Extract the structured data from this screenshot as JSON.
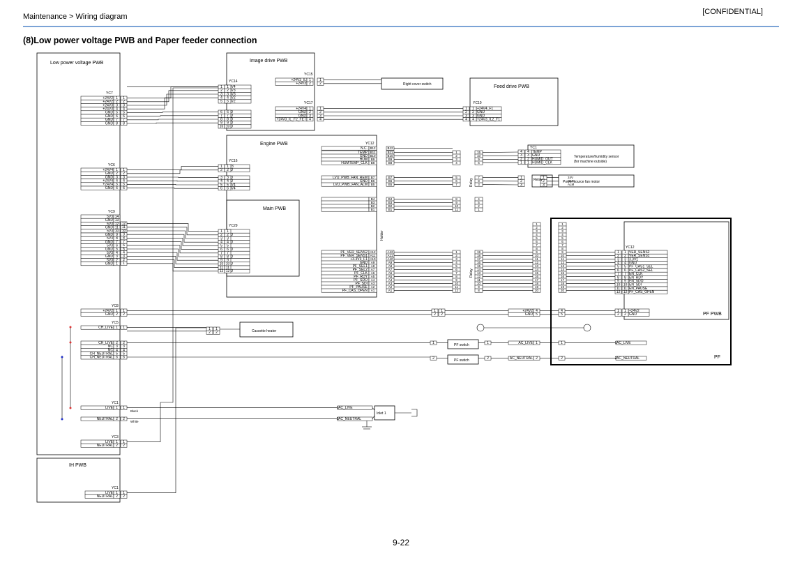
{
  "header": {
    "breadcrumb": "Maintenance > Wiring diagram",
    "confidential": "[CONFIDENTIAL]"
  },
  "page_title": "(8)Low power voltage PWB and Paper feeder connection",
  "page_number": "9-22",
  "diagram": {
    "boards": {
      "lvpwb": "Low power voltage PWB",
      "image_drive": "Image drive PWB",
      "feed_drive": "Feed drive PWB",
      "engine": "Engine PWB",
      "main": "Main PWB",
      "ih": "IH PWB",
      "pf_pwb": "PF PWB",
      "pf": "PF"
    },
    "components": {
      "right_cover_switch": "Right cover switch",
      "temp_sensor_1": "Temperature/humidity sensor",
      "temp_sensor_2": "(for machine outside)",
      "fan_motor": "Power source fan motor",
      "cassette_heater": "Cassette heater",
      "pf_switch": "PF switch",
      "inlet": "Inlet 1",
      "relay": "Relay",
      "holder": "Holder",
      "black": "Black",
      "white": "White"
    },
    "connectors": {
      "yc7": {
        "label": "YC7",
        "pins": [
          "1",
          "2",
          "3",
          "4",
          "5",
          "6",
          "7",
          "8"
        ],
        "signals": [
          "+24V2",
          "+24V2",
          "+24V3",
          "+24V3",
          "GND",
          "GND",
          "GND",
          "GND"
        ]
      },
      "yc6": {
        "label": "YC6",
        "pins": [
          "1",
          "2",
          "3",
          "4",
          "5",
          "6"
        ],
        "signals": [
          "+24V4",
          "GND",
          "GND",
          "+24V4",
          "+24V4",
          "GND"
        ]
      },
      "yc9": {
        "label": "YC9",
        "pins": [
          "14",
          "13",
          "12",
          "11",
          "10",
          "9",
          "8",
          "7",
          "6",
          "5",
          "4",
          "3",
          "2",
          "1"
        ],
        "signals": [
          "5V3",
          "GND",
          "5V3",
          "GND",
          "5V3",
          "GND",
          "5V3",
          "GND",
          "5V3",
          "GND",
          "5V3",
          "GND",
          "5V3",
          "GND"
        ]
      },
      "yc8": {
        "label": "YC8",
        "pins": [
          "1",
          "2"
        ],
        "signals": [
          "+24V2",
          "GND"
        ]
      },
      "yc5": {
        "label": "YC5",
        "pins": [
          "1",
          "2",
          "3",
          "4",
          "5",
          "6"
        ],
        "signals": [
          "CH_LIVE",
          "CH_LIVE",
          "NC",
          "NC",
          "CH_NEUTRAL",
          "CH_NEUTRAL"
        ]
      },
      "yc1_lv": {
        "label": "YC1",
        "pins": [
          "1",
          "2"
        ],
        "signals": [
          "LIVE",
          "NEUTRAL"
        ]
      },
      "yc3": {
        "label": "YC3",
        "pins": [
          "1",
          "2"
        ],
        "signals": [
          "LIVE",
          "NEUTRAL"
        ]
      },
      "yc1_ih": {
        "label": "YC1",
        "pins": [
          "1",
          "2"
        ],
        "signals": [
          "LIVE",
          "NEUTRAL"
        ]
      },
      "yc14": {
        "label": "YC14",
        "pins": [
          "1",
          "2",
          "3",
          "4",
          "5",
          "6",
          "7",
          "8",
          "9",
          "10"
        ],
        "signals": [
          "+24V4",
          "+24V3",
          "+24V3",
          "+24V2",
          "+24V2",
          "GND",
          "GND",
          "GND",
          "GND",
          "GND"
        ]
      },
      "yc15": {
        "label": "YC15",
        "pins": [
          "1",
          "2"
        ],
        "signals": [
          "+24V3_IL",
          "+24V3"
        ]
      },
      "yc17": {
        "label": "YC17",
        "pins": [
          "1",
          "2",
          "3",
          "4"
        ],
        "signals": [
          "+24V4",
          "GND",
          "GND",
          "+24V3_IL_F2_FET"
        ]
      },
      "yc10": {
        "label": "YC10",
        "pins": [
          "1",
          "2",
          "3",
          "4"
        ],
        "signals": [
          "+24V4_F1",
          "GND",
          "GND",
          "+24V3_IL2_F1"
        ]
      },
      "yc16": {
        "label": "YC16",
        "pins": [
          "1",
          "2",
          "3",
          "4",
          "5",
          "6"
        ],
        "signals": [
          "+5V3",
          "GND",
          "GND",
          "GND",
          "+24V4",
          "+24V4"
        ]
      },
      "yc29": {
        "label": "YC29",
        "pins": [
          "1",
          "2",
          "3",
          "4",
          "5",
          "6",
          "7",
          "8",
          "9",
          "10",
          "11",
          "12"
        ],
        "signals": [
          "5V",
          "GND",
          "5V",
          "GND",
          "5V",
          "GND",
          "5V",
          "GND",
          "5V",
          "GND",
          "5V",
          "GND"
        ]
      },
      "yc12_engine": {
        "label": "YC12",
        "pins": [
          "B12",
          "B11",
          "B10",
          "B9",
          "B8",
          "B7",
          "B6",
          "B5",
          "B4",
          "B3",
          "B2",
          "B1",
          "A12",
          "A11",
          "A10",
          "A9",
          "A8",
          "A7",
          "A6",
          "A5",
          "A4",
          "A3",
          "A2",
          "A1"
        ],
        "signals": [
          "N.C.",
          "TEMP",
          "GND",
          "HUM",
          "HUMTEMP_CLK",
          "LVU_PWB_FAN_REM",
          "GND",
          "LVU_PWB_FAN_ALM",
          "",
          "",
          "",
          "",
          "PF_VER_SENS2",
          "PF_VER_SENS1",
          "+3.3V3_F1",
          "GND",
          "PF_SEL1",
          "PF_SEL2",
          "PF_CLK",
          "PF_RDY",
          "PF_SDO",
          "PF_SDI",
          "PF_PAUSE",
          "PF_CAS_OPEN"
        ]
      },
      "yc1_temp": {
        "label": "YC1",
        "pins": [
          "4",
          "3",
          "2",
          "1"
        ],
        "signals": [
          "TEMP",
          "GND",
          "HUMID_OUT",
          "HUMID_CLK"
        ]
      },
      "fan": {
        "signals": [
          "24V",
          "GND",
          "ALM"
        ]
      },
      "yc12_pf": {
        "label": "YC12",
        "pins": [
          "1",
          "2",
          "3",
          "4",
          "5",
          "6",
          "7",
          "8",
          "9",
          "10",
          "11",
          "12"
        ],
        "signals": [
          "VER_SENS2",
          "VER_SENS1",
          "3.3V1",
          "GND",
          "PF_CAS1_SEL",
          "PF_CAS2_SEL",
          "EN_CLK",
          "EN_RDY",
          "EN_SDO",
          "EN_SDI",
          "EN_PAUSE",
          "PF_CAS_OPEN"
        ]
      },
      "yc1_pf": {
        "pins": [
          "1",
          "2"
        ],
        "signals": [
          "+24V2",
          "GND"
        ]
      },
      "ac": {
        "live": "AC_LIVE",
        "neutral": "AC_NEUTRAL"
      }
    }
  }
}
